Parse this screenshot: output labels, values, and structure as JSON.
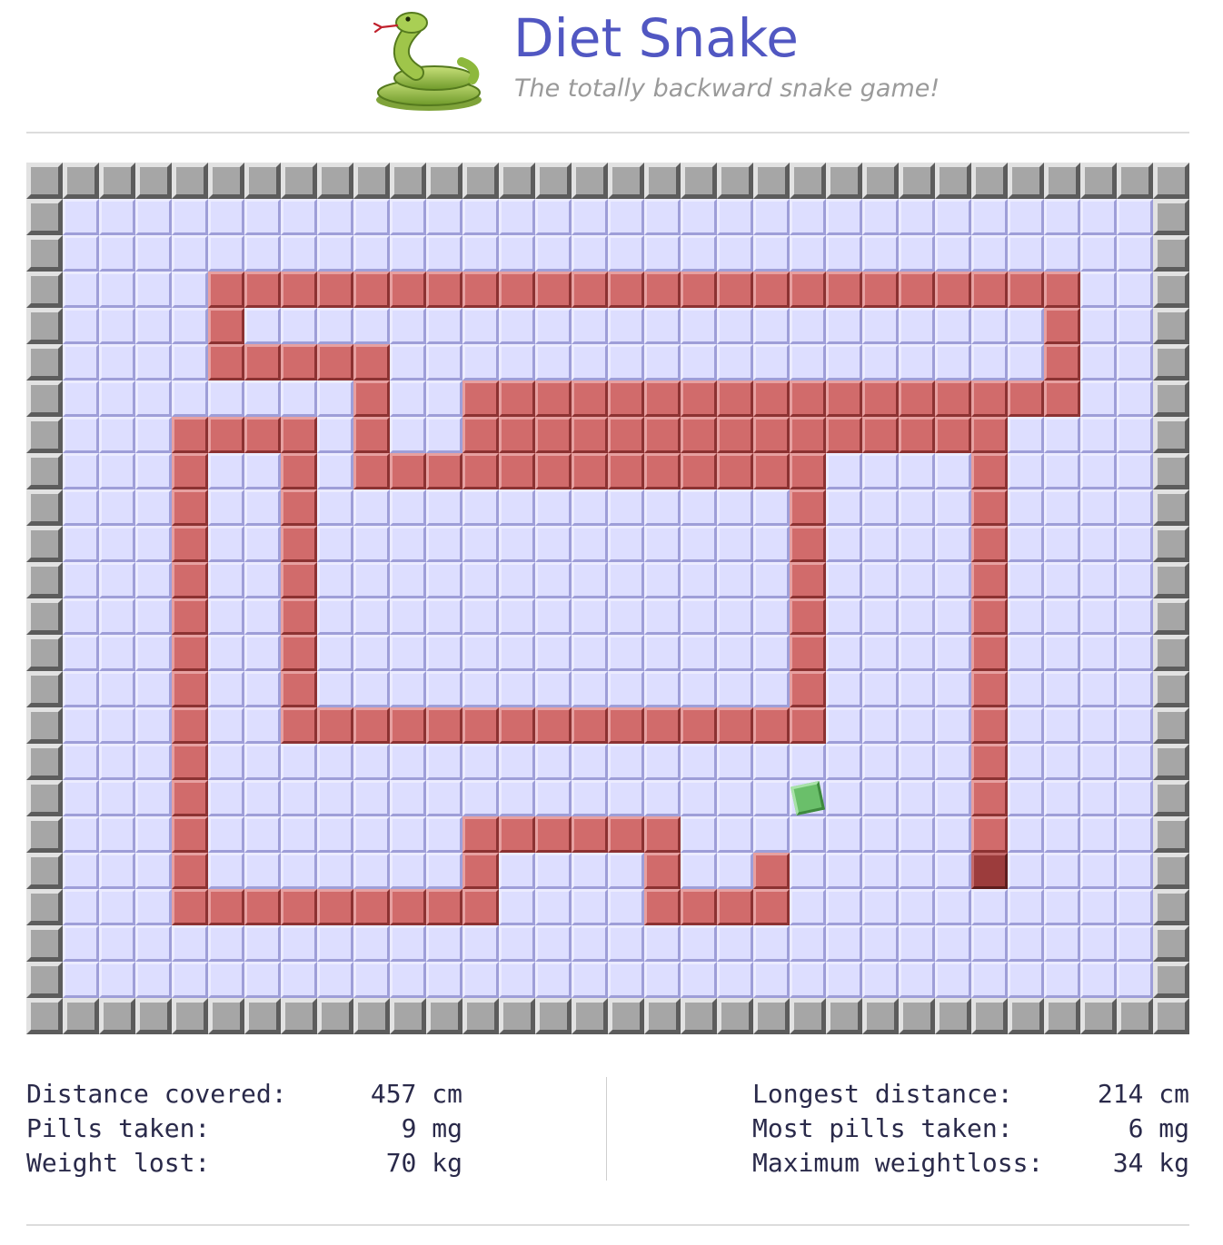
{
  "header": {
    "title": "Diet Snake",
    "subtitle": "The totally backward snake game!",
    "logo_icon": "snake-emoji-icon"
  },
  "game": {
    "grid_cols": 32,
    "grid_rows": 24,
    "colors": {
      "empty_tile": "#dddeff",
      "wall_tile": "#a6a6a6",
      "snake_body": "#d16b6b",
      "snake_head": "#9c3c3c",
      "pill": "#6abf6a"
    },
    "snake_head_cell": [
      26,
      19
    ],
    "pill_cell": [
      21,
      17
    ],
    "snake_segments": [
      [
        26,
        18
      ],
      [
        26,
        17
      ],
      [
        26,
        16
      ],
      [
        26,
        15
      ],
      [
        26,
        14
      ],
      [
        26,
        13
      ],
      [
        26,
        12
      ],
      [
        26,
        11
      ],
      [
        26,
        10
      ],
      [
        26,
        9
      ],
      [
        26,
        8
      ],
      [
        26,
        7
      ],
      [
        25,
        7
      ],
      [
        24,
        7
      ],
      [
        23,
        7
      ],
      [
        22,
        7
      ],
      [
        21,
        7
      ],
      [
        20,
        7
      ],
      [
        19,
        7
      ],
      [
        18,
        7
      ],
      [
        17,
        7
      ],
      [
        16,
        7
      ],
      [
        15,
        7
      ],
      [
        14,
        7
      ],
      [
        13,
        7
      ],
      [
        12,
        7
      ],
      [
        12,
        6
      ],
      [
        13,
        6
      ],
      [
        14,
        6
      ],
      [
        15,
        6
      ],
      [
        16,
        6
      ],
      [
        17,
        6
      ],
      [
        18,
        6
      ],
      [
        19,
        6
      ],
      [
        20,
        6
      ],
      [
        21,
        6
      ],
      [
        22,
        6
      ],
      [
        23,
        6
      ],
      [
        24,
        6
      ],
      [
        25,
        6
      ],
      [
        26,
        6
      ],
      [
        27,
        6
      ],
      [
        28,
        6
      ],
      [
        28,
        5
      ],
      [
        28,
        4
      ],
      [
        28,
        3
      ],
      [
        27,
        3
      ],
      [
        26,
        3
      ],
      [
        25,
        3
      ],
      [
        24,
        3
      ],
      [
        23,
        3
      ],
      [
        22,
        3
      ],
      [
        21,
        3
      ],
      [
        20,
        3
      ],
      [
        19,
        3
      ],
      [
        18,
        3
      ],
      [
        17,
        3
      ],
      [
        16,
        3
      ],
      [
        15,
        3
      ],
      [
        14,
        3
      ],
      [
        13,
        3
      ],
      [
        12,
        3
      ],
      [
        11,
        3
      ],
      [
        10,
        3
      ],
      [
        9,
        3
      ],
      [
        8,
        3
      ],
      [
        7,
        3
      ],
      [
        6,
        3
      ],
      [
        5,
        3
      ],
      [
        5,
        4
      ],
      [
        5,
        5
      ],
      [
        6,
        5
      ],
      [
        7,
        5
      ],
      [
        8,
        5
      ],
      [
        9,
        5
      ],
      [
        9,
        6
      ],
      [
        9,
        7
      ],
      [
        9,
        8
      ],
      [
        10,
        8
      ],
      [
        11,
        8
      ],
      [
        12,
        8
      ],
      [
        13,
        8
      ],
      [
        14,
        8
      ],
      [
        15,
        8
      ],
      [
        16,
        8
      ],
      [
        17,
        8
      ],
      [
        18,
        8
      ],
      [
        19,
        8
      ],
      [
        20,
        8
      ],
      [
        21,
        8
      ],
      [
        21,
        9
      ],
      [
        21,
        10
      ],
      [
        21,
        11
      ],
      [
        21,
        12
      ],
      [
        21,
        13
      ],
      [
        21,
        14
      ],
      [
        21,
        15
      ],
      [
        20,
        15
      ],
      [
        19,
        15
      ],
      [
        18,
        15
      ],
      [
        17,
        15
      ],
      [
        16,
        15
      ],
      [
        15,
        15
      ],
      [
        14,
        15
      ],
      [
        13,
        15
      ],
      [
        12,
        15
      ],
      [
        11,
        15
      ],
      [
        10,
        15
      ],
      [
        9,
        15
      ],
      [
        8,
        15
      ],
      [
        7,
        15
      ],
      [
        7,
        14
      ],
      [
        7,
        13
      ],
      [
        7,
        12
      ],
      [
        7,
        11
      ],
      [
        7,
        10
      ],
      [
        7,
        9
      ],
      [
        7,
        8
      ],
      [
        7,
        7
      ],
      [
        6,
        7
      ],
      [
        5,
        7
      ],
      [
        4,
        7
      ],
      [
        4,
        8
      ],
      [
        4,
        9
      ],
      [
        4,
        10
      ],
      [
        4,
        11
      ],
      [
        4,
        12
      ],
      [
        4,
        13
      ],
      [
        4,
        14
      ],
      [
        4,
        15
      ],
      [
        4,
        16
      ],
      [
        4,
        17
      ],
      [
        4,
        18
      ],
      [
        4,
        19
      ],
      [
        4,
        20
      ],
      [
        5,
        20
      ],
      [
        6,
        20
      ],
      [
        7,
        20
      ],
      [
        8,
        20
      ],
      [
        9,
        20
      ],
      [
        10,
        20
      ],
      [
        11,
        20
      ],
      [
        12,
        20
      ],
      [
        12,
        19
      ],
      [
        12,
        18
      ],
      [
        13,
        18
      ],
      [
        14,
        18
      ],
      [
        15,
        18
      ],
      [
        16,
        18
      ],
      [
        17,
        18
      ],
      [
        17,
        19
      ],
      [
        17,
        20
      ],
      [
        18,
        20
      ],
      [
        19,
        20
      ],
      [
        20,
        20
      ],
      [
        20,
        19
      ]
    ]
  },
  "stats": {
    "left": [
      {
        "label": "Distance covered:",
        "value": "457 cm"
      },
      {
        "label": "Pills taken:",
        "value": "9 mg"
      },
      {
        "label": "Weight lost:",
        "value": "70 kg"
      }
    ],
    "right": [
      {
        "label": "Longest distance:",
        "value": "214 cm"
      },
      {
        "label": "Most pills taken:",
        "value": "6 mg"
      },
      {
        "label": "Maximum weightloss:",
        "value": "34 kg"
      }
    ]
  }
}
